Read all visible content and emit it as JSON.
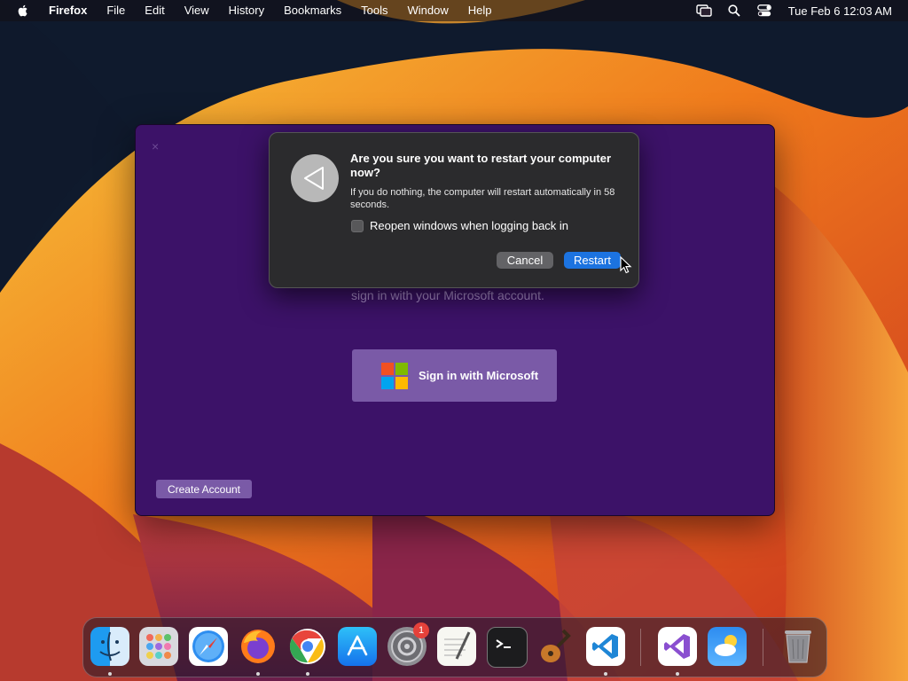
{
  "menubar": {
    "app_name": "Firefox",
    "items": [
      "File",
      "Edit",
      "View",
      "History",
      "Bookmarks",
      "Tools",
      "Window",
      "Help"
    ],
    "clock": "Tue Feb 6  12:03 AM"
  },
  "app_window": {
    "close_glyph": "×",
    "subtitle": "sign in with your Microsoft account.",
    "sign_in_label": "Sign in with Microsoft",
    "create_account_label": "Create Account"
  },
  "dialog": {
    "title": "Are you sure you want to restart your computer now?",
    "message": "If you do nothing, the computer will restart automatically in 58 seconds.",
    "checkbox_label": "Reopen windows when logging back in",
    "checkbox_checked": false,
    "cancel_label": "Cancel",
    "restart_label": "Restart"
  },
  "dock": {
    "items": [
      {
        "name": "finder-icon",
        "running": true
      },
      {
        "name": "launchpad-icon",
        "running": false
      },
      {
        "name": "safari-icon",
        "running": false
      },
      {
        "name": "firefox-icon",
        "running": true
      },
      {
        "name": "chrome-icon",
        "running": true
      },
      {
        "name": "app-store-icon",
        "running": false
      },
      {
        "name": "system-settings-icon",
        "running": false,
        "badge": "1"
      },
      {
        "name": "textedit-icon",
        "running": false
      },
      {
        "name": "terminal-icon",
        "running": false
      },
      {
        "name": "instruments-icon",
        "running": false
      },
      {
        "name": "vscode-icon",
        "running": true
      },
      {
        "name": "visual-studio-icon",
        "running": true
      },
      {
        "name": "weather-icon",
        "running": false
      },
      {
        "name": "trash-icon",
        "running": false
      }
    ]
  },
  "colors": {
    "window_bg": "#3c1268",
    "accent_button": "#7a5aa7",
    "restart_blue": "#1c73e0",
    "ms_red": "#f25022",
    "ms_green": "#7fba00",
    "ms_blue": "#00a4ef",
    "ms_yellow": "#ffb900"
  }
}
